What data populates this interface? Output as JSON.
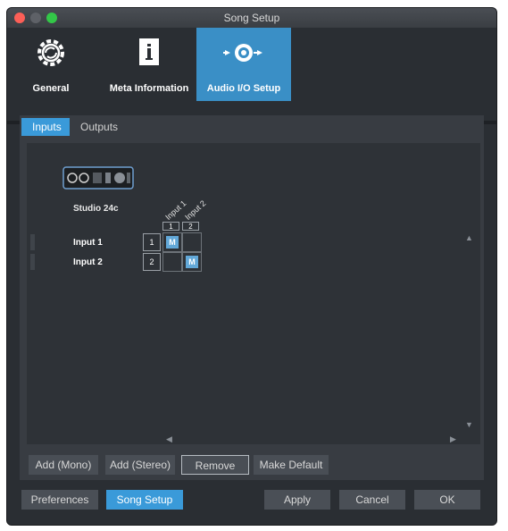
{
  "window": {
    "title": "Song Setup"
  },
  "toolbar": {
    "items": [
      {
        "label": "General",
        "icon": "gear-icon"
      },
      {
        "label": "Meta Information",
        "icon": "info-document-icon"
      },
      {
        "label": "Audio I/O Setup",
        "icon": "speaker-io-icon",
        "selected": true
      }
    ]
  },
  "tabs": [
    {
      "label": "Inputs",
      "selected": true
    },
    {
      "label": "Outputs",
      "selected": false
    }
  ],
  "device": {
    "name": "Studio 24c",
    "icon": "audio-interface-icon"
  },
  "matrix": {
    "columns": [
      {
        "name": "Input 1",
        "number": "1"
      },
      {
        "name": "Input 2",
        "number": "2"
      }
    ],
    "rows": [
      {
        "label": "Input 1",
        "number": "1",
        "cells": [
          "M",
          ""
        ]
      },
      {
        "label": "Input 2",
        "number": "2",
        "cells": [
          "",
          "M"
        ]
      }
    ]
  },
  "scroll_arrows": {
    "up": "▲",
    "down": "▼",
    "left": "◀",
    "right": "▶"
  },
  "actions": {
    "add_mono": "Add (Mono)",
    "add_stereo": "Add (Stereo)",
    "remove": "Remove",
    "make_default": "Make Default"
  },
  "footer": {
    "preferences": "Preferences",
    "song_setup": "Song Setup",
    "apply": "Apply",
    "cancel": "Cancel",
    "ok": "OK"
  },
  "colors": {
    "accent": "#3a9ad9",
    "selected_toolbar": "#3a8fc6",
    "window_bg": "#2a2e33",
    "panel_bg": "#2e3237"
  }
}
